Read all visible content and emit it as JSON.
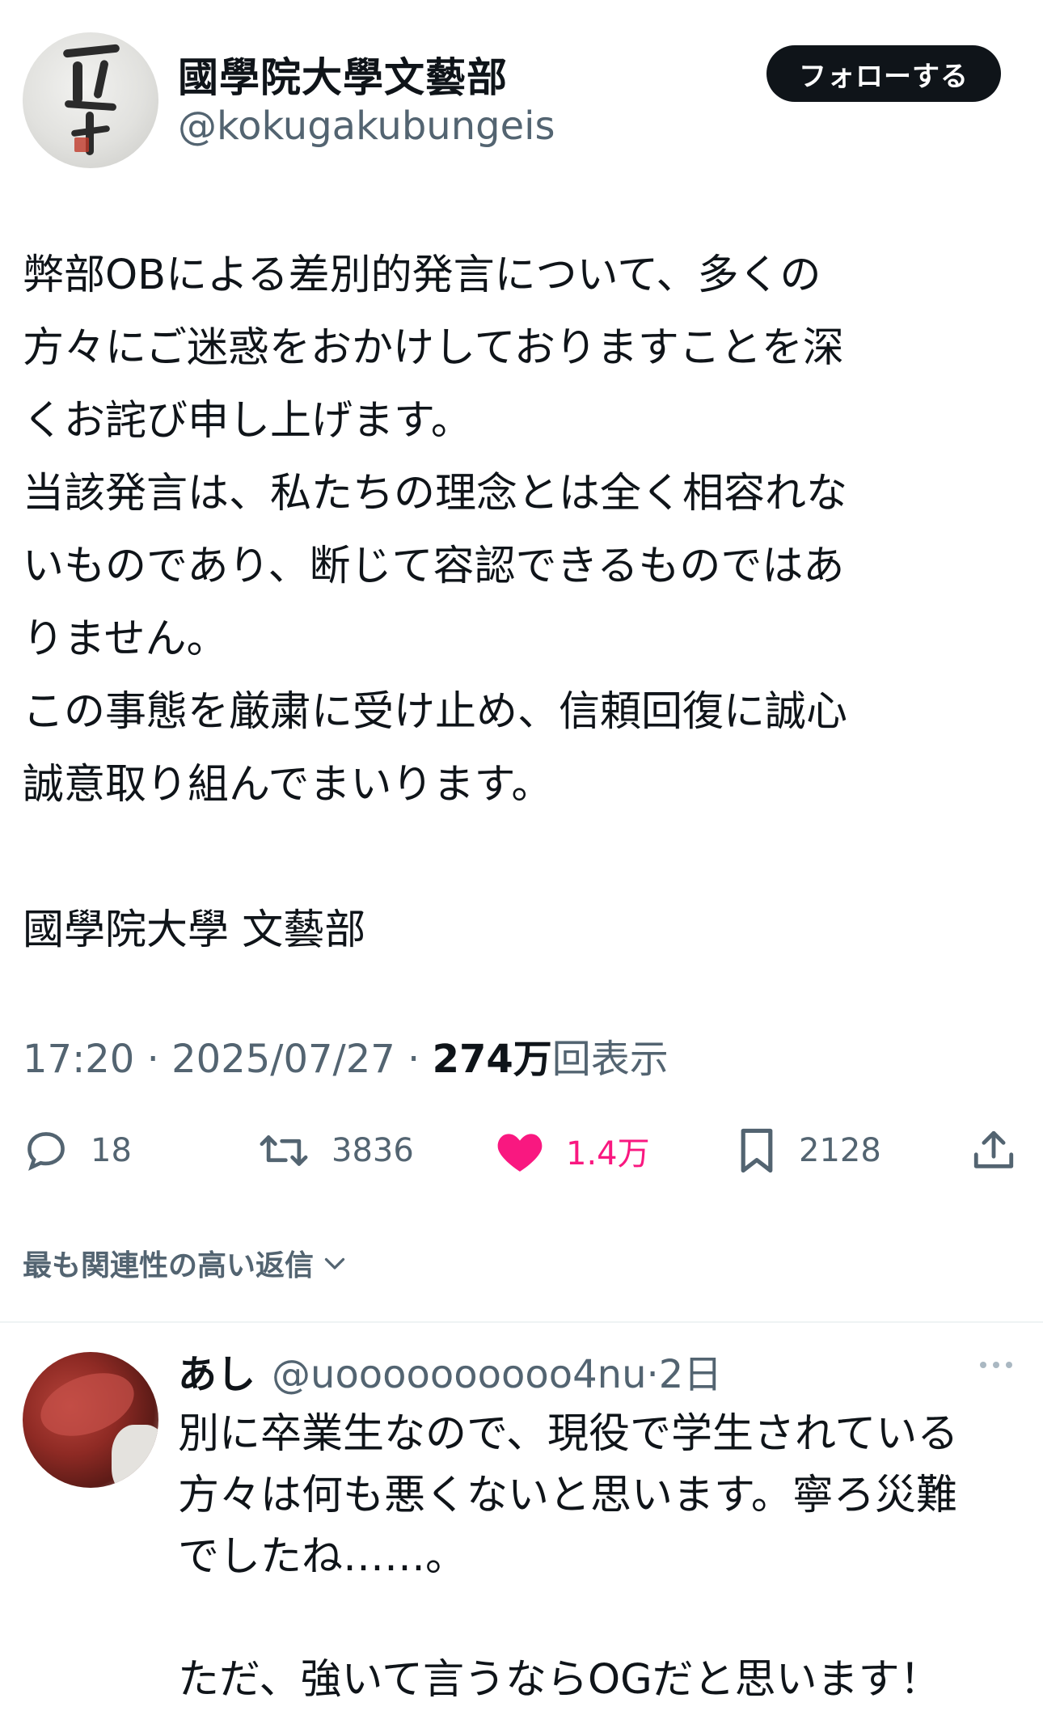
{
  "account": {
    "display_name": "國學院大學文藝部",
    "handle": "@kokugakubungeis",
    "follow_label": "フォローする"
  },
  "tweet": {
    "lines": [
      "弊部OBによる差別的発言について、多くの",
      "方々にご迷惑をおかけしておりますことを深",
      "くお詫び申し上げます。",
      "当該発言は、私たちの理念とは全く相容れな",
      "いものであり、断じて容認できるものではあ",
      "りません。",
      "この事態を厳粛に受け止め、信頼回復に誠心",
      "誠意取り組んでまいります。"
    ],
    "signature": "國學院大學 文藝部",
    "time": "17:20",
    "date": "2025/07/27",
    "views_number": "274万",
    "views_suffix": "回表示",
    "separator": "·"
  },
  "actions": {
    "replies": "18",
    "retweets": "3836",
    "likes": "1.4万",
    "bookmarks": "2128",
    "liked": true,
    "like_color": "#f91880"
  },
  "replies_sort": {
    "label": "最も関連性の高い返信"
  },
  "reply": {
    "name": "あし",
    "handle": "@uoooooooooo4nu",
    "separator": "·",
    "time": "2日",
    "lines": [
      "別に卒業生なので、現役で学生されている",
      "方々は何も悪くないと思います。寧ろ災難",
      "でしたね……。",
      "",
      "ただ、強いて言うならOGだと思います！"
    ]
  },
  "colors": {
    "text": "#0f1419",
    "secondary": "#536471",
    "divider": "#eff3f4"
  }
}
